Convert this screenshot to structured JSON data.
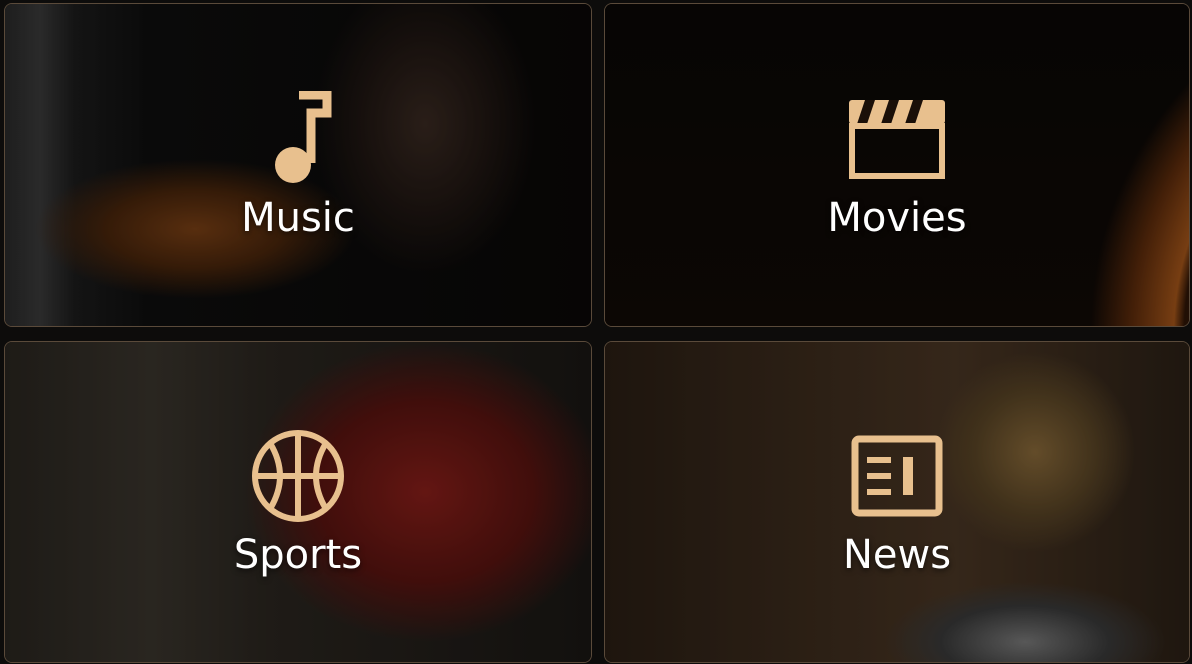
{
  "accent_color": "#E8C08E",
  "tiles": [
    {
      "id": "music",
      "label": "Music",
      "icon": "music-note-icon"
    },
    {
      "id": "movies",
      "label": "Movies",
      "icon": "clapperboard-icon"
    },
    {
      "id": "sports",
      "label": "Sports",
      "icon": "basketball-icon"
    },
    {
      "id": "news",
      "label": "News",
      "icon": "newspaper-icon"
    }
  ]
}
